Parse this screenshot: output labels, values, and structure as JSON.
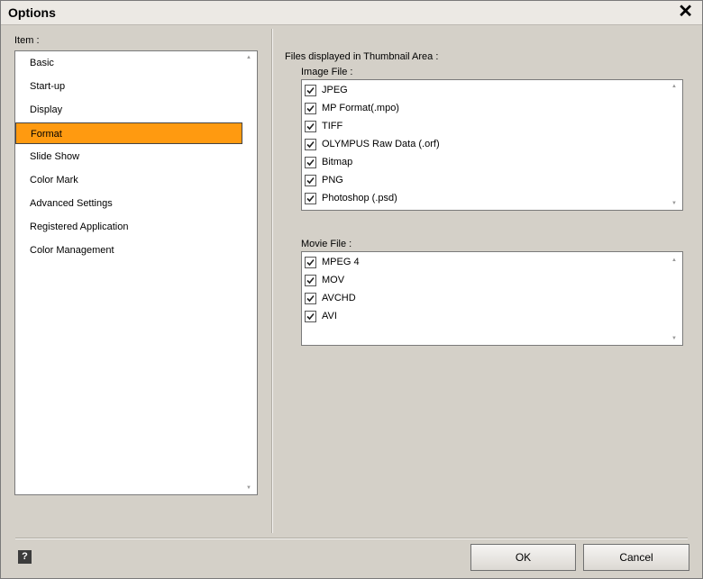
{
  "window": {
    "title": "Options",
    "close_glyph": "✕"
  },
  "left_panel": {
    "label": "Item :",
    "items": [
      {
        "label": "Basic",
        "selected": false
      },
      {
        "label": "Start-up",
        "selected": false
      },
      {
        "label": "Display",
        "selected": false
      },
      {
        "label": "Format",
        "selected": true
      },
      {
        "label": "Slide Show",
        "selected": false
      },
      {
        "label": "Color Mark",
        "selected": false
      },
      {
        "label": "Advanced Settings",
        "selected": false
      },
      {
        "label": "Registered Application",
        "selected": false
      },
      {
        "label": "Color Management",
        "selected": false
      }
    ]
  },
  "right_panel": {
    "heading": "Files displayed in Thumbnail Area :",
    "image_file": {
      "label": "Image File :",
      "items": [
        {
          "label": "JPEG",
          "checked": true
        },
        {
          "label": "MP Format(.mpo)",
          "checked": true
        },
        {
          "label": "TIFF",
          "checked": true
        },
        {
          "label": "OLYMPUS Raw Data (.orf)",
          "checked": true
        },
        {
          "label": "Bitmap",
          "checked": true
        },
        {
          "label": "PNG",
          "checked": true
        },
        {
          "label": "Photoshop (.psd)",
          "checked": true
        }
      ]
    },
    "movie_file": {
      "label": "Movie File :",
      "items": [
        {
          "label": "MPEG 4",
          "checked": true
        },
        {
          "label": "MOV",
          "checked": true
        },
        {
          "label": "AVCHD",
          "checked": true
        },
        {
          "label": "AVI",
          "checked": true
        }
      ]
    }
  },
  "footer": {
    "help_glyph": "?",
    "ok_label": "OK",
    "cancel_label": "Cancel"
  },
  "colors": {
    "selection": "#ff9a10",
    "dialog_bg": "#d4d0c8"
  },
  "icons": {
    "checkbox": "checkmark-icon",
    "scroll_up": "scroll-up-arrow-icon",
    "scroll_down": "scroll-down-arrow-icon"
  }
}
